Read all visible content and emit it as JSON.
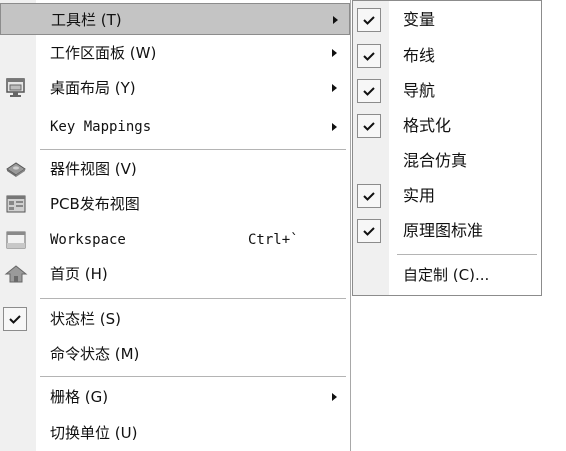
{
  "main_menu": {
    "items": [
      {
        "label": "工具栏 (T)",
        "has_submenu": true,
        "highlighted": true
      },
      {
        "label": "工作区面板 (W)",
        "has_submenu": true
      },
      {
        "label": "桌面布局 (Y)",
        "has_submenu": true,
        "icon": "desktop-layout-icon"
      },
      {
        "label": "Key Mappings",
        "has_submenu": true
      },
      {
        "label": "器件视图 (V)",
        "icon": "device-view-icon"
      },
      {
        "label": "PCB发布视图",
        "icon": "pcb-release-view-icon"
      },
      {
        "label": "Workspace",
        "shortcut": "Ctrl+`",
        "icon": "workspace-icon"
      },
      {
        "label": "首页 (H)",
        "icon": "home-icon"
      },
      {
        "label": "状态栏 (S)",
        "checked": true
      },
      {
        "label": "命令状态 (M)"
      },
      {
        "label": "栅格 (G)",
        "has_submenu": true
      },
      {
        "label": "切换单位 (U)"
      }
    ]
  },
  "toolbars_submenu": {
    "items": [
      {
        "label": "变量",
        "checked": true
      },
      {
        "label": "布线",
        "checked": true
      },
      {
        "label": "导航",
        "checked": true
      },
      {
        "label": "格式化",
        "checked": true
      },
      {
        "label": "混合仿真",
        "checked": false
      },
      {
        "label": "实用",
        "checked": true
      },
      {
        "label": "原理图标准",
        "checked": true
      },
      {
        "label": "自定制 (C)..."
      }
    ]
  },
  "colors": {
    "highlight_bg": "#c4c4c4",
    "icon_strip": "#f0f0f0",
    "text": "#111111",
    "separator": "#b4b4b4"
  }
}
